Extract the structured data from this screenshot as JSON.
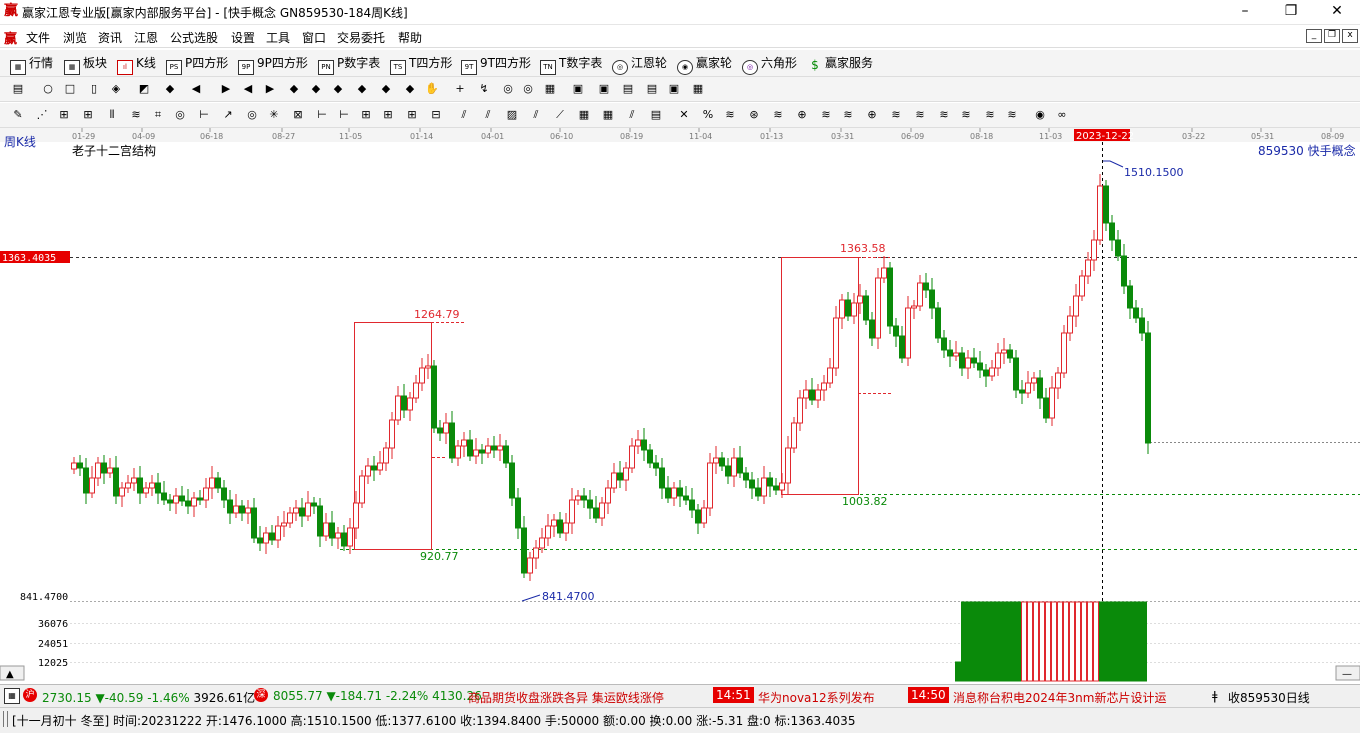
{
  "window": {
    "title": "赢家江恩专业版[赢家内部服务平台] - [快手概念  GN859530-184周K线]",
    "logo": "赢"
  },
  "menubar": {
    "items": [
      "文件",
      "浏览",
      "资讯",
      "江恩",
      "公式选股",
      "设置",
      "工具",
      "窗口",
      "交易委托",
      "帮助"
    ]
  },
  "funcbar": {
    "items": [
      {
        "label": "行情",
        "icon": "table-icon"
      },
      {
        "label": "板块",
        "icon": "grid-icon"
      },
      {
        "label": "K线",
        "icon": "candle-icon"
      },
      {
        "label": "P四方形",
        "icon": "ps-icon",
        "badge": "PS"
      },
      {
        "label": "9P四方形",
        "icon": "9p-icon",
        "badge": "9P"
      },
      {
        "label": "P数字表",
        "icon": "pn-icon",
        "badge": "PN"
      },
      {
        "label": "T四方形",
        "icon": "ts-icon",
        "badge": "TS"
      },
      {
        "label": "9T四方形",
        "icon": "9t-icon",
        "badge": "9T"
      },
      {
        "label": "T数字表",
        "icon": "tn-icon",
        "badge": "TN"
      },
      {
        "label": "江恩轮",
        "icon": "wheel-icon"
      },
      {
        "label": "赢家轮",
        "icon": "winner-wheel-icon"
      },
      {
        "label": "六角形",
        "icon": "hexagon-icon"
      },
      {
        "label": "赢家服务",
        "icon": "dollar-icon"
      }
    ]
  },
  "chart_header": {
    "period_label": "周K线",
    "indicator_name": "老子十二宫结构",
    "instrument": "859530  快手概念",
    "cursor_date": "2023-12-22"
  },
  "time_axis": {
    "ticks": [
      "01-29",
      "04-09",
      "06-18",
      "08-27",
      "11-05",
      "01-14",
      "04-01",
      "06-10",
      "08-19",
      "11-04",
      "01-13",
      "03-31",
      "06-09",
      "08-18",
      "11-03",
      "2023-12-22",
      "03-22",
      "05-31",
      "08-09"
    ]
  },
  "price_labels": {
    "hline_price": "1363.4035",
    "high_label": "1510.1500",
    "low_label": "841.4700",
    "low_axis": "841.4700",
    "box1_top": "1264.79",
    "box1_bottom": "920.77",
    "box2_top": "1363.58",
    "box2_bottom": "1003.82"
  },
  "volume_axis": {
    "labels": [
      "36076",
      "24051",
      "12025"
    ]
  },
  "statusbar": {
    "index1": {
      "value": "2730.15",
      "change": "▼-40.59",
      "pct": "-1.46%",
      "amount": "3926.61亿"
    },
    "index2": {
      "value": "8055.77",
      "change": "▼-184.71",
      "pct": "-2.24%",
      "amount": "4130.26"
    },
    "ticker_text": "商品期货收盘涨跌各异 集运欧线涨停",
    "news": [
      {
        "time": "14:51",
        "text": "华为nova12系列发布"
      },
      {
        "time": "14:50",
        "text": "消息称台积电2024年3nm新芯片设计运"
      }
    ],
    "right_text": "收859530日线"
  },
  "infobar": {
    "text": "[十一月初十 冬至] 时间:20231222 开:1476.1000 高:1510.1500 低:1377.6100 收:1394.8400 手:50000 额:0.00 换:0.00 涨:-5.31 盘:0 标:1363.4035"
  },
  "colors": {
    "up": "#e0282e",
    "down": "#0a8a0a",
    "box": "#e0282e",
    "green_line": "#0a8a0a",
    "blue_label": "#1a2aa8",
    "price_tag_bg": "#e60000"
  }
}
